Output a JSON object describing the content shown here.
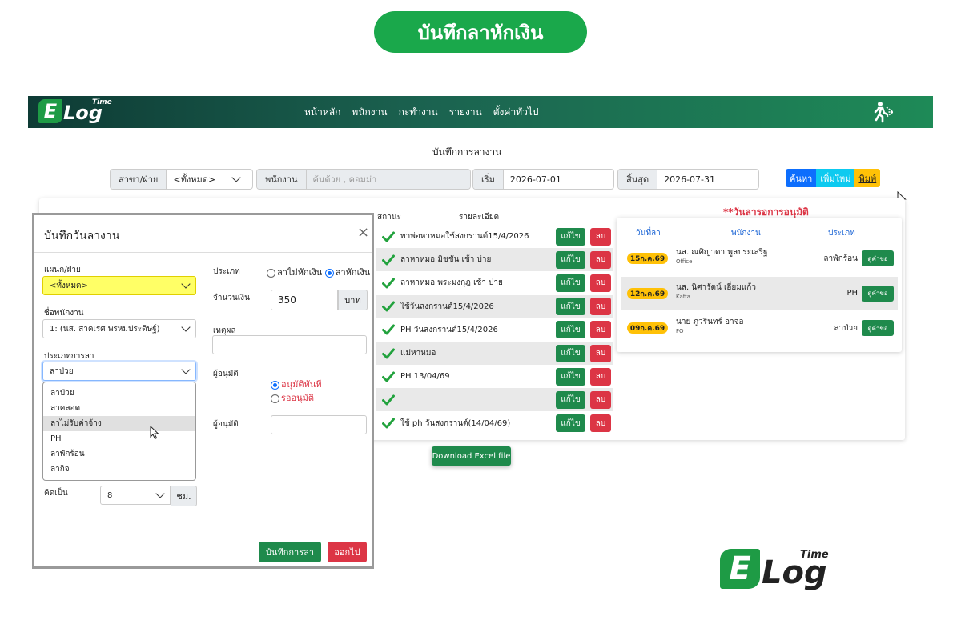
{
  "banner": "บันทึกลาหักเงิน",
  "brand": {
    "e": "E",
    "log": "Log",
    "time": "Time"
  },
  "nav": [
    "หน้าหลัก",
    "พนักงาน",
    "กะทำงาน",
    "รายงาน",
    "ตั้งค่าทั่วไป"
  ],
  "page_title": "บันทึกการลางาน",
  "filters": {
    "branch_label": "สาขา/ฝ่าย",
    "branch_value": "<ทั้งหมด>",
    "employee_label": "พนักงาน",
    "employee_placeholder": "ค้นด้วย , คอมม่า",
    "start_label": "เริ่ม",
    "start_value": "2026-07-01",
    "end_label": "สิ้นสุด",
    "end_value": "2026-07-31"
  },
  "buttons": {
    "search": "ค้นหา",
    "add": "เพิ่มใหม่",
    "print": "พิมพ์"
  },
  "table": {
    "status_header": "สถานะ",
    "detail_header": "รายละเอียด",
    "edit": "แก้ไข",
    "delete": "ลบ",
    "rows": [
      "พาพ่อหาหมอใช้สงกรานต์15/4/2026",
      "ลาหาหมอ มิชชั่น เช้า บ่าย",
      "ลาหาหมอ พระมงกุฎ เช้า บ่าย",
      "ใช้วันสงกรานต์15/4/2026",
      "PH วันสงกรานต์15/4/2026",
      "แม่หาหมอ",
      "PH 13/04/69",
      "",
      "ใช้ ph วันสงกรานต์(14/04/69)"
    ]
  },
  "excel_button": "Download Excel file",
  "approval": {
    "title": "**วันลารอการอนุมัติ",
    "col_date": "วันที่ลา",
    "col_employee": "พนักงาน",
    "col_type": "ประเภท",
    "view": "ดูคำขอ",
    "rows": [
      {
        "date": "15ก.ค.69",
        "name": "นส. ณศิญาดา พูลประเสริฐ",
        "dept": "Office",
        "type": "ลาพักร้อน"
      },
      {
        "date": "12ก.ค.69",
        "name": "นส. นิศารัตน์ เอี่ยมแก้ว",
        "dept": "Kaffa",
        "type": "PH"
      },
      {
        "date": "09ก.ค.69",
        "name": "นาย ภูวรินทร์ อาจอ",
        "dept": "FO",
        "type": "ลาป่วย"
      }
    ]
  },
  "modal": {
    "title": "บันทึกวันลางาน",
    "dept_label": "แผนก/ฝ่าย",
    "dept_value": "<ทั้งหมด>",
    "emp_label": "ชื่อพนักงาน",
    "emp_value": "1: (นส. สาคเรศ พรหมประดิษฐ์)",
    "leave_type_label": "ประเภทการลา",
    "leave_type_value": "ลาป่วย",
    "options": [
      "ลาป่วย",
      "ลาคลอด",
      "ลาไม่รับค่าจ้าง",
      "PH",
      "ลาพักร้อน",
      "ลากิจ"
    ],
    "type_label": "ประเภท",
    "radio_no_deduct": "ลาไม่หักเงิน",
    "radio_deduct": "ลาหักเงิน",
    "amount_label": "จำนวนเงิน",
    "amount_value": "350",
    "amount_unit": "บาท",
    "reason_label": "เหตุผล",
    "approver_label": "ผู้อนุมัติ",
    "approve_now": "อนุมัติทันที",
    "pending": "รออนุมัติ",
    "approver2_label": "ผู้อนุมัติ",
    "calc_label": "คิดเป็น",
    "calc_value": "8",
    "calc_unit": "ชม.",
    "save": "บันทึกการลา",
    "exit": "ออกไป"
  }
}
